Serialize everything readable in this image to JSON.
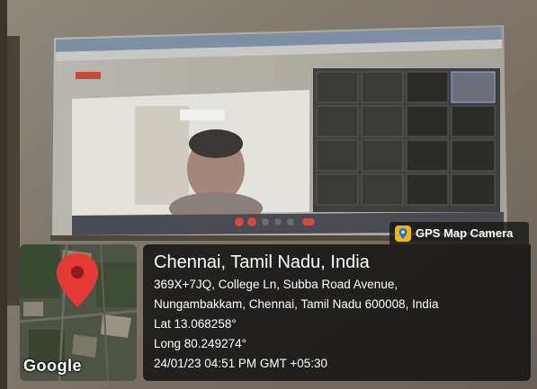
{
  "stamp": {
    "app_name": "GPS Map Camera",
    "location_title": "Chennai, Tamil Nadu, India",
    "address_line1": "369X+7JQ, College Ln, Subba Road Avenue,",
    "address_line2": "Nungambakkam, Chennai, Tamil Nadu 600008, India",
    "latitude": "Lat 13.068258°",
    "longitude": "Long 80.249274°",
    "datetime": "24/01/23 04:51 PM GMT +05:30",
    "map_logo": "Google"
  },
  "colors": {
    "pin": "#e53935",
    "overlay": "#0a0a0a",
    "text": "#ffffff"
  }
}
